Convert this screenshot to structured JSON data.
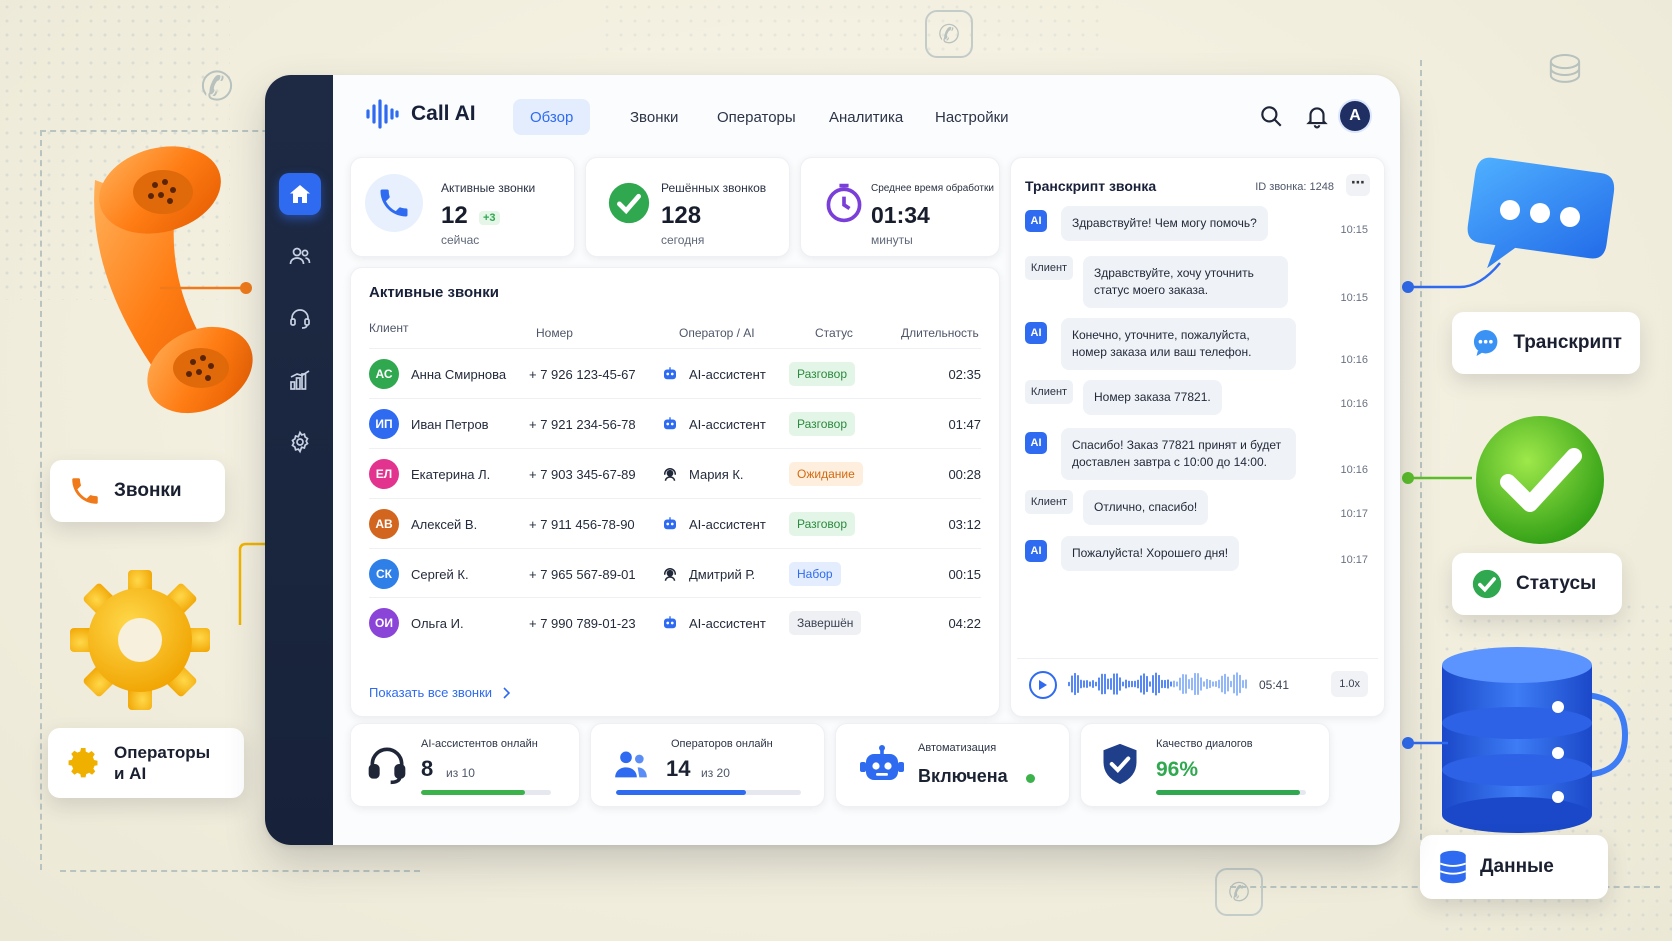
{
  "app": {
    "title": "Call AI"
  },
  "nav": {
    "tabs": [
      {
        "label": "Обзор",
        "active": true
      },
      {
        "label": "Звонки",
        "active": false
      },
      {
        "label": "Операторы",
        "active": false
      },
      {
        "label": "Аналитика",
        "active": false
      },
      {
        "label": "Настройки",
        "active": false
      }
    ],
    "avatar_initial": "A"
  },
  "stats": {
    "active": {
      "label": "Активные звонки",
      "value": "12",
      "delta": "+3",
      "sub": "сейчас"
    },
    "resolved": {
      "label": "Решённых звонков",
      "value": "128",
      "sub": "сегодня"
    },
    "avg_time": {
      "label": "Среднее время обработки",
      "value": "01:34",
      "sub": "минуты"
    }
  },
  "calls_table": {
    "title": "Активные звонки",
    "columns": [
      "Клиент",
      "Номер",
      "Оператор / AI",
      "Статус",
      "Длительность"
    ],
    "rows": [
      {
        "initials": "АС",
        "color": "#2fa84f",
        "name": "Анна Смирнова",
        "phone": "+ 7 926 123-45-67",
        "operator": "AI-ассистент",
        "op_type": "ai",
        "status": "Разговор",
        "status_kind": "talk",
        "duration": "02:35"
      },
      {
        "initials": "ИП",
        "color": "#2f6bf0",
        "name": "Иван Петров",
        "phone": "+ 7 921 234-56-78",
        "operator": "AI-ассистент",
        "op_type": "ai",
        "status": "Разговор",
        "status_kind": "talk",
        "duration": "01:47"
      },
      {
        "initials": "ЕЛ",
        "color": "#e2338f",
        "name": "Екатерина Л.",
        "phone": "+ 7 903 345-67-89",
        "operator": "Мария К.",
        "op_type": "human-female",
        "status": "Ожидание",
        "status_kind": "wait",
        "duration": "00:28"
      },
      {
        "initials": "АВ",
        "color": "#d3661f",
        "name": "Алексей В.",
        "phone": "+ 7 911 456-78-90",
        "operator": "AI-ассистент",
        "op_type": "ai",
        "status": "Разговор",
        "status_kind": "talk",
        "duration": "03:12"
      },
      {
        "initials": "СК",
        "color": "#2f7fe8",
        "name": "Сергей К.",
        "phone": "+ 7 965 567-89-01",
        "operator": "Дмитрий Р.",
        "op_type": "human",
        "status": "Набор",
        "status_kind": "dial",
        "duration": "00:15"
      },
      {
        "initials": "ОИ",
        "color": "#8a45d8",
        "name": "Ольга И.",
        "phone": "+ 7 990 789-01-23",
        "operator": "AI-ассистент",
        "op_type": "ai",
        "status": "Завершён",
        "status_kind": "done",
        "duration": "04:22"
      }
    ],
    "show_all": "Показать все звонки"
  },
  "transcript": {
    "title": "Транскрипт звонка",
    "call_id": "ID звонка: 1248",
    "messages": [
      {
        "role": "AI",
        "text": "Здравствуйте! Чем могу помочь?",
        "time": "10:15"
      },
      {
        "role": "Клиент",
        "text": "Здравствуйте, хочу уточнить статус моего заказа.",
        "time": "10:15"
      },
      {
        "role": "AI",
        "text": "Конечно, уточните, пожалуйста, номер заказа или ваш телефон.",
        "time": "10:16"
      },
      {
        "role": "Клиент",
        "text": "Номер заказа 77821.",
        "time": "10:16"
      },
      {
        "role": "AI",
        "text": "Спасибо! Заказ 77821 принят и будет доставлен завтра с 10:00 до 14:00.",
        "time": "10:16"
      },
      {
        "role": "Клиент",
        "text": "Отлично, спасибо!",
        "time": "10:17"
      },
      {
        "role": "AI",
        "text": "Пожалуйста! Хорошего дня!",
        "time": "10:17"
      }
    ],
    "player": {
      "duration": "05:41",
      "speed": "1.0x"
    }
  },
  "bottom": {
    "ai_online": {
      "label": "AI-ассистентов онлайн",
      "value": "8",
      "of": "из 10",
      "fraction": 0.8,
      "color": "#3bb34a"
    },
    "operators_online": {
      "label": "Операторов онлайн",
      "value": "14",
      "of": "из 20",
      "fraction": 0.7,
      "color": "#2f6bf0"
    },
    "automation": {
      "label": "Автоматизация",
      "value": "Включена",
      "color": "#3bb34a"
    },
    "quality": {
      "label": "Качество диалогов",
      "value": "96%",
      "fraction": 0.96,
      "color": "#2fa84f"
    }
  },
  "floating_labels": {
    "calls": "Звонки",
    "operators": "Операторы и AI",
    "transcript": "Транскрипт",
    "statuses": "Статусы",
    "data": "Данные"
  }
}
